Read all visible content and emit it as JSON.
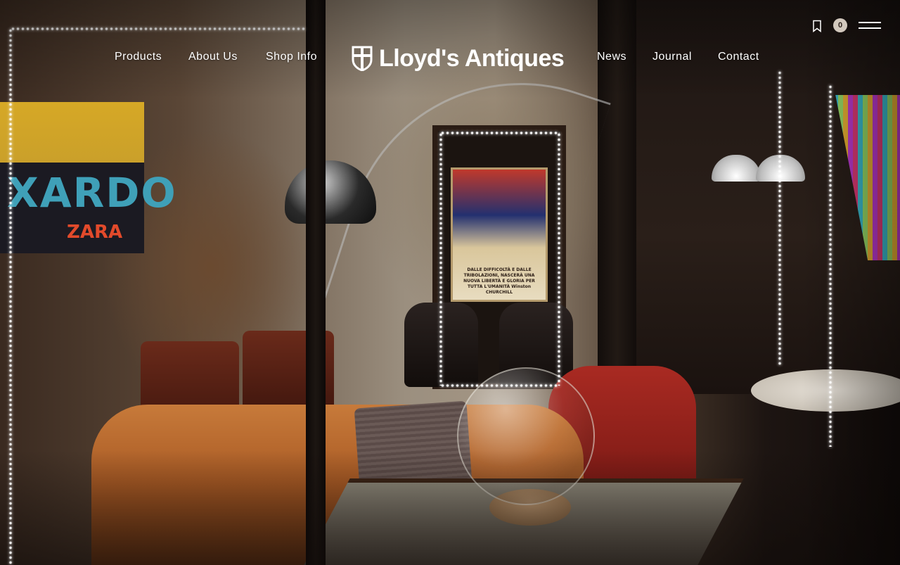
{
  "header": {
    "logo_text": "Lloyd's Antiques",
    "nav_left": [
      "Products",
      "About Us",
      "Shop Info"
    ],
    "nav_right": [
      "News",
      "Journal",
      "Contact"
    ],
    "cart_count": "0",
    "icons": {
      "logo": "shield-cross-icon",
      "bookmark": "bookmark-icon",
      "menu": "hamburger-menu-icon"
    }
  },
  "hero": {
    "poster_left_big": "XARDO",
    "poster_left_small": "ZARA",
    "poster_center_caption": "DALLE DIFFICOLTÀ E DALLE TRIBOLAZIONI, NASCERÀ UNA NUOVA LIBERTÀ E GLORIA PER TUTTA L'UMANITÀ Winston CHURCHILL"
  },
  "colors": {
    "nav_text": "#ffffff",
    "badge_bg": "#d2c8bd",
    "badge_text": "#2a1f19"
  }
}
